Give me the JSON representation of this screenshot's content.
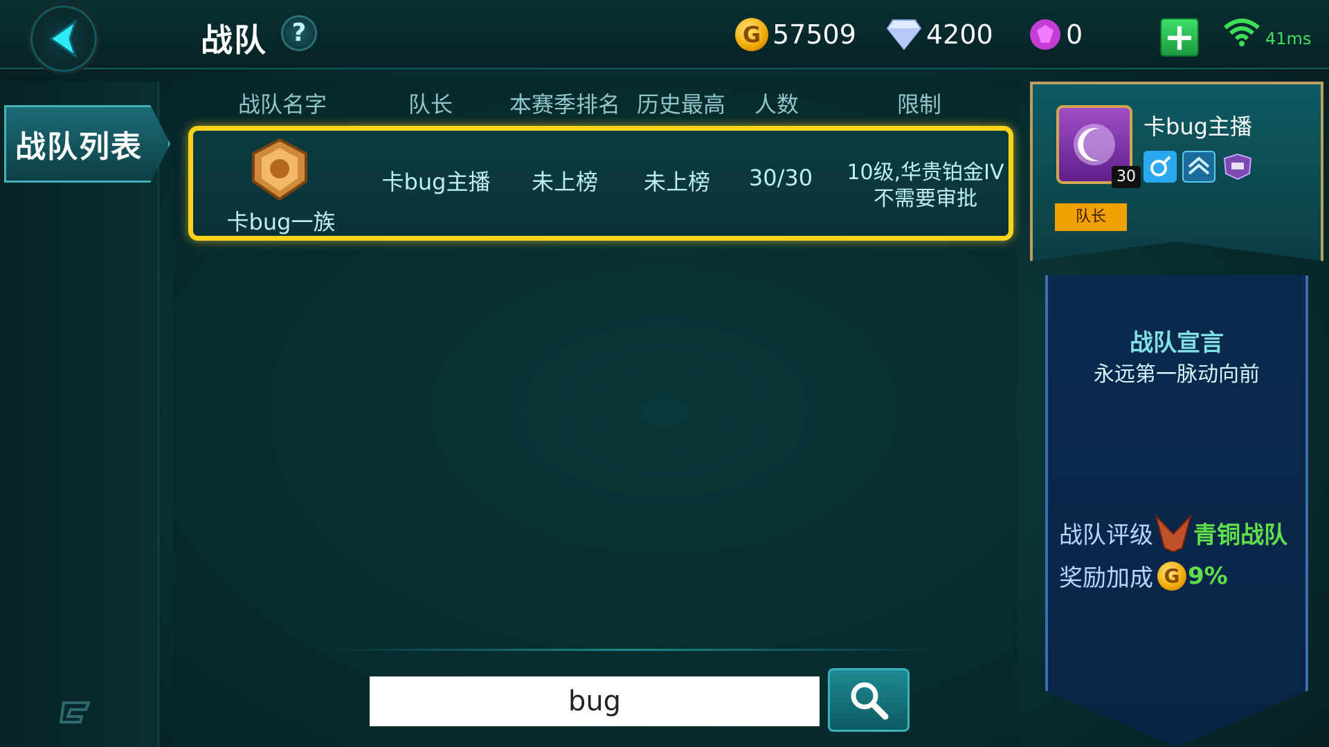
{
  "header": {
    "title": "战队",
    "help_label": "?",
    "gold": "57509",
    "gold_icon_letter": "G",
    "diamond": "4200",
    "gem": "0",
    "add_label": "+",
    "ping": "41ms"
  },
  "sidebar": {
    "tabs": [
      {
        "label": "战队列表"
      }
    ]
  },
  "list": {
    "columns": [
      "战队名字",
      "队长",
      "本赛季排名",
      "历史最高",
      "人数",
      "限制"
    ],
    "rows": [
      {
        "team_name": "卡bug一族",
        "leader": "卡bug主播",
        "season_rank": "未上榜",
        "best_rank": "未上榜",
        "members": "30/30",
        "limit_line1": "10级,华贵铂金IV",
        "limit_line2": "不需要审批"
      }
    ]
  },
  "search": {
    "value": "bug"
  },
  "profile": {
    "leader_name": "卡bug主播",
    "level": "30",
    "role": "队长",
    "manifesto_title": "战队宣言",
    "manifesto": "永远第一脉动向前",
    "rating_label": "战队评级",
    "rating_value": "青铜战队",
    "bonus_label": "奖励加成",
    "bonus_icon_letter": "G",
    "bonus_value": "9%"
  },
  "colors": {
    "highlight": "#ffd21a",
    "green": "#5fe04a",
    "accent": "#3fb3b8"
  }
}
